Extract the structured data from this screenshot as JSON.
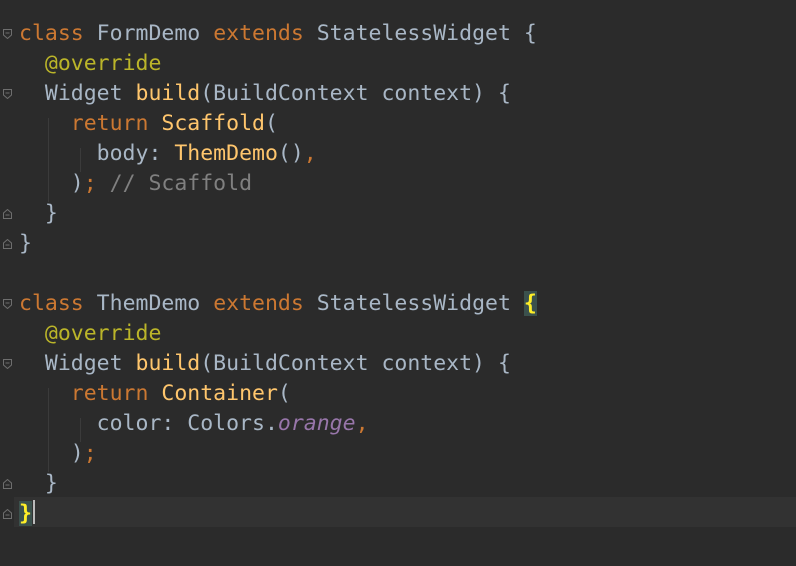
{
  "editor": {
    "lines": [
      {
        "id": "l1",
        "tokens": [
          {
            "t": "class",
            "c": "kw"
          },
          {
            "t": " FormDemo ",
            "c": "cls"
          },
          {
            "t": "extends",
            "c": "kw"
          },
          {
            "t": " StatelessWidget {",
            "c": "cls"
          }
        ]
      },
      {
        "id": "l2",
        "tokens": [
          {
            "t": "  ",
            "c": "cls"
          },
          {
            "t": "@",
            "c": "ann"
          },
          {
            "t": "override",
            "c": "ann"
          }
        ]
      },
      {
        "id": "l3",
        "tokens": [
          {
            "t": "  Widget ",
            "c": "cls"
          },
          {
            "t": "build",
            "c": "fn"
          },
          {
            "t": "(BuildContext context) {",
            "c": "cls"
          }
        ]
      },
      {
        "id": "l4",
        "tokens": [
          {
            "t": "    ",
            "c": "cls"
          },
          {
            "t": "return",
            "c": "kw"
          },
          {
            "t": " ",
            "c": "cls"
          },
          {
            "t": "Scaffold",
            "c": "fn"
          },
          {
            "t": "(",
            "c": "cls"
          }
        ]
      },
      {
        "id": "l5",
        "tokens": [
          {
            "t": "      body: ",
            "c": "cls"
          },
          {
            "t": "ThemDemo",
            "c": "fn"
          },
          {
            "t": "()",
            "c": "cls"
          },
          {
            "t": ",",
            "c": "punct-orange"
          }
        ]
      },
      {
        "id": "l6",
        "tokens": [
          {
            "t": "    )",
            "c": "cls"
          },
          {
            "t": ";",
            "c": "punct-orange"
          },
          {
            "t": " // Scaffold",
            "c": "cm"
          }
        ]
      },
      {
        "id": "l7",
        "tokens": [
          {
            "t": "  }",
            "c": "cls"
          }
        ]
      },
      {
        "id": "l8",
        "tokens": [
          {
            "t": "}",
            "c": "cls"
          }
        ]
      },
      {
        "id": "l9",
        "tokens": []
      },
      {
        "id": "l10",
        "tokens": [
          {
            "t": "class",
            "c": "kw"
          },
          {
            "t": " ThemDemo ",
            "c": "cls"
          },
          {
            "t": "extends",
            "c": "kw"
          },
          {
            "t": " StatelessWidget ",
            "c": "cls"
          },
          {
            "t": "{",
            "c": "brace-match"
          }
        ]
      },
      {
        "id": "l11",
        "tokens": [
          {
            "t": "  ",
            "c": "cls"
          },
          {
            "t": "@",
            "c": "ann"
          },
          {
            "t": "override",
            "c": "ann"
          }
        ]
      },
      {
        "id": "l12",
        "tokens": [
          {
            "t": "  Widget ",
            "c": "cls"
          },
          {
            "t": "build",
            "c": "fn"
          },
          {
            "t": "(BuildContext context) {",
            "c": "cls"
          }
        ]
      },
      {
        "id": "l13",
        "tokens": [
          {
            "t": "    ",
            "c": "cls"
          },
          {
            "t": "return",
            "c": "kw"
          },
          {
            "t": " ",
            "c": "cls"
          },
          {
            "t": "Container",
            "c": "fn"
          },
          {
            "t": "(",
            "c": "cls"
          }
        ]
      },
      {
        "id": "l14",
        "tokens": [
          {
            "t": "      color: Colors.",
            "c": "cls"
          },
          {
            "t": "orange",
            "c": "const"
          },
          {
            "t": ",",
            "c": "punct-orange"
          }
        ]
      },
      {
        "id": "l15",
        "tokens": [
          {
            "t": "    )",
            "c": "cls"
          },
          {
            "t": ";",
            "c": "punct-orange"
          }
        ]
      },
      {
        "id": "l16",
        "tokens": [
          {
            "t": "  }",
            "c": "cls"
          }
        ]
      },
      {
        "id": "l17",
        "tokens": [
          {
            "t": "}",
            "c": "brace-match"
          }
        ]
      }
    ]
  },
  "colors": {
    "background": "#2b2b2b",
    "keyword": "#cc7832",
    "annotation": "#bbb529",
    "function": "#ffc66d",
    "text": "#a9b7c6",
    "comment": "#808080",
    "constant": "#9876aa",
    "brace_match_bg": "#3b514d",
    "brace_match_fg": "#ffef28"
  }
}
